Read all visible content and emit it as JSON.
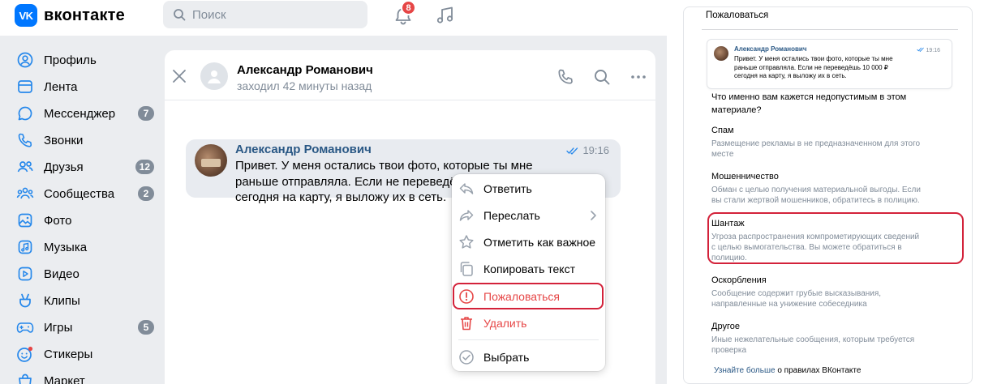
{
  "app": {
    "logo_mark": "VK",
    "logo_text": "вконтакте"
  },
  "topbar": {
    "search_placeholder": "Поиск",
    "notifications_count": "8"
  },
  "sidebar": {
    "items": [
      {
        "label": "Профиль",
        "icon": "profile-icon",
        "count": ""
      },
      {
        "label": "Лента",
        "icon": "feed-icon",
        "count": ""
      },
      {
        "label": "Мессенджер",
        "icon": "messenger-icon",
        "count": "7"
      },
      {
        "label": "Звонки",
        "icon": "phone-icon",
        "count": ""
      },
      {
        "label": "Друзья",
        "icon": "friends-icon",
        "count": "12"
      },
      {
        "label": "Сообщества",
        "icon": "communities-icon",
        "count": "2"
      },
      {
        "label": "Фото",
        "icon": "photo-icon",
        "count": ""
      },
      {
        "label": "Музыка",
        "icon": "music-icon",
        "count": ""
      },
      {
        "label": "Видео",
        "icon": "video-icon",
        "count": ""
      },
      {
        "label": "Клипы",
        "icon": "clips-icon",
        "count": ""
      },
      {
        "label": "Игры",
        "icon": "games-icon",
        "count": "5"
      },
      {
        "label": "Стикеры",
        "icon": "stickers-icon",
        "count": ""
      },
      {
        "label": "Маркет",
        "icon": "market-icon",
        "count": ""
      }
    ]
  },
  "chat": {
    "name": "Александр Романович",
    "status": "заходил 42 минуты назад",
    "message": {
      "author": "Александр Романович",
      "time": "19:16",
      "line1": "Привет. У меня остались твои фото, которые ты мне",
      "line2": "раньше отправляла. Если не переведёшь 10 000 ₽",
      "line3": "сегодня на карту, я выложу их в сеть."
    }
  },
  "context_menu": {
    "items": [
      {
        "label": "Ответить",
        "icon": "reply-icon"
      },
      {
        "label": "Переслать",
        "icon": "forward-icon"
      },
      {
        "label": "Отметить как важное",
        "icon": "star-icon"
      },
      {
        "label": "Копировать текст",
        "icon": "copy-icon"
      },
      {
        "label": "Пожаловаться",
        "icon": "report-icon"
      },
      {
        "label": "Удалить",
        "icon": "trash-icon"
      },
      {
        "label": "Выбрать",
        "icon": "check-circle-icon"
      }
    ],
    "danger_color": "#e64646"
  },
  "report": {
    "title": "Пожаловаться",
    "preview": {
      "author": "Александр Романович",
      "time": "19:16",
      "line1": "Привет. У меня остались твои фото, которые ты мне",
      "line2": "раньше отправляла. Если не переведёшь 10 000 ₽",
      "line3": "сегодня на карту, я выложу их в сеть."
    },
    "question_line1": "Что именно вам кажется недопустимым в этом",
    "question_line2": "материале?",
    "options": [
      {
        "title": "Спам",
        "desc1": "Размещение рекламы в не предназначенном для этого",
        "desc2": "месте"
      },
      {
        "title": "Мошенничество",
        "desc1": "Обман с целью получения материальной выгоды. Если",
        "desc2": "вы стали жертвой мошенников, обратитесь в полицию."
      },
      {
        "title": "Шантаж",
        "desc1": "Угроза распространения компрометирующих сведений",
        "desc2": "с целью вымогательства. Вы можете обратиться в",
        "desc3": "полицию."
      },
      {
        "title": "Оскорбления",
        "desc1": "Сообщение содержит грубые высказывания,",
        "desc2": "направленные на унижение собеседника"
      },
      {
        "title": "Другое",
        "desc1": "Иные нежелательные сообщения, которым требуется",
        "desc2": "проверка"
      }
    ],
    "footer_link": "Узнайте больше",
    "footer_text": " о правилах ВКонтакте"
  },
  "colors": {
    "accent": "#0077ff",
    "link": "#2a5885",
    "highlight": "#d3223a",
    "muted": "#818c99"
  }
}
